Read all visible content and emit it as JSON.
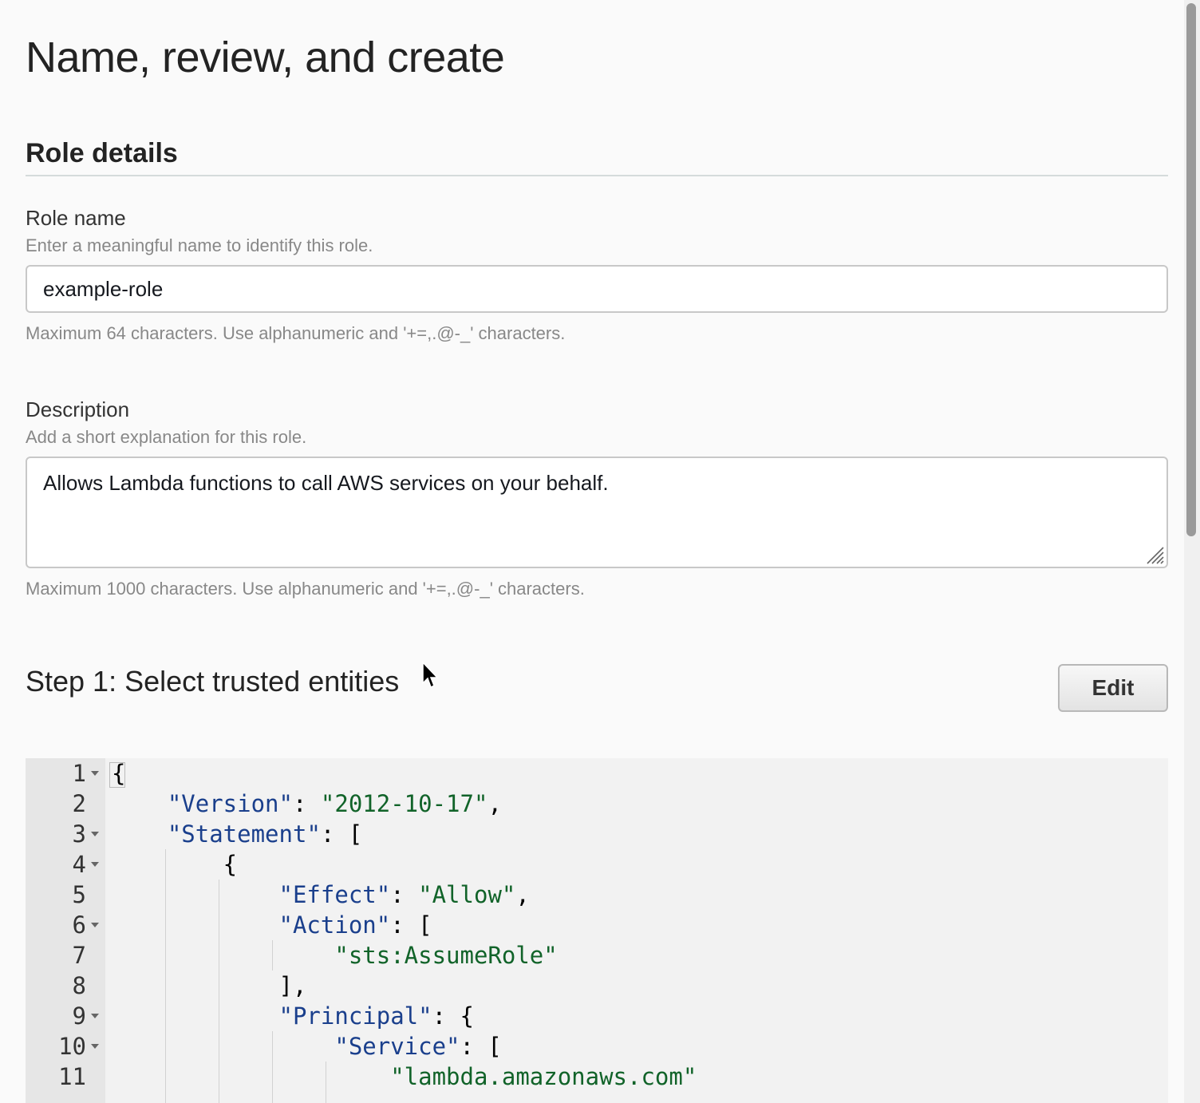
{
  "page": {
    "title": "Name, review, and create"
  },
  "role_details": {
    "section_title": "Role details",
    "role_name": {
      "label": "Role name",
      "description": "Enter a meaningful name to identify this role.",
      "value": "example-role",
      "constraint": "Maximum 64 characters. Use alphanumeric and '+=,.@-_' characters."
    },
    "description": {
      "label": "Description",
      "description": "Add a short explanation for this role.",
      "value": "Allows Lambda functions to call AWS services on your behalf.",
      "constraint": "Maximum 1000 characters. Use alphanumeric and '+=,.@-_' characters."
    }
  },
  "step1": {
    "title": "Step 1: Select trusted entities",
    "edit_label": "Edit"
  },
  "code": {
    "line_numbers": [
      "1",
      "2",
      "3",
      "4",
      "5",
      "6",
      "7",
      "8",
      "9",
      "10",
      "11"
    ],
    "lines": [
      "{",
      "    \"Version\": \"2012-10-17\",",
      "    \"Statement\": [",
      "        {",
      "            \"Effect\": \"Allow\",",
      "            \"Action\": [",
      "                \"sts:AssumeRole\"",
      "            ],",
      "            \"Principal\": {",
      "                \"Service\": [",
      "                    \"lambda.amazonaws.com\""
    ]
  },
  "colors": {
    "json_key": "#1a3f8c",
    "json_string": "#116329",
    "background": "#fafafa"
  },
  "icons": [
    "chevron-down-icon",
    "resize-handle-icon",
    "mouse-pointer-icon"
  ]
}
